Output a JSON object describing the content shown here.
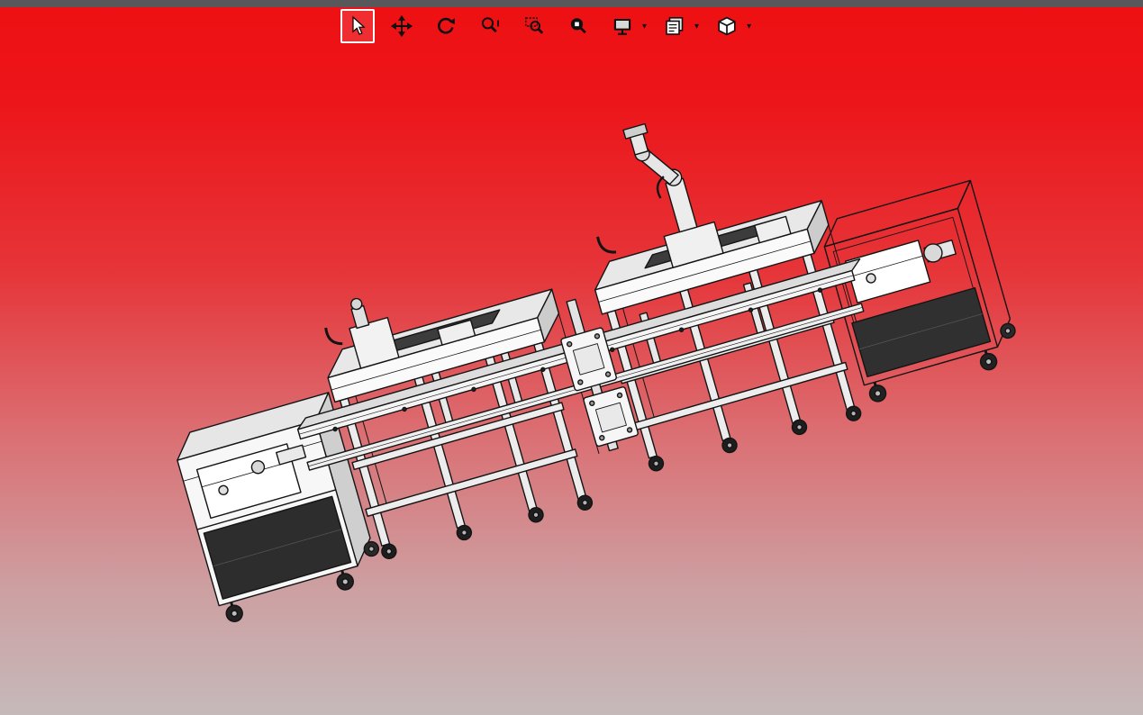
{
  "window": {
    "top_bar_color": "#58585a"
  },
  "viewport": {
    "background_gradient_top": "#ee1013",
    "background_gradient_bottom": "#c6b9ba",
    "model_fill": "#ffffff",
    "model_edge": "#141414",
    "model_description": "3D CAD assembly of an automated machine line: two framed process modules with tabletops, a small robot arm on top, center fixture plates, and rolling equipment carts with casters at both ends, all on aluminum extrusion frames with connecting rails"
  },
  "toolbar": {
    "buttons": [
      {
        "name": "select",
        "icon": "cursor-arrow-icon",
        "active": true,
        "has_dropdown": false
      },
      {
        "name": "pan",
        "icon": "pan-arrows-icon",
        "active": false,
        "has_dropdown": false
      },
      {
        "name": "rotate",
        "icon": "rotate-arrows-icon",
        "active": false,
        "has_dropdown": false
      },
      {
        "name": "zoom-in-out",
        "icon": "magnifier-zoom-icon",
        "active": false,
        "has_dropdown": false
      },
      {
        "name": "zoom-window",
        "icon": "magnifier-window-icon",
        "active": false,
        "has_dropdown": false
      },
      {
        "name": "zoom-fit",
        "icon": "magnifier-fit-icon",
        "active": false,
        "has_dropdown": false
      },
      {
        "name": "display-mode",
        "icon": "monitor-icon",
        "active": false,
        "has_dropdown": true
      },
      {
        "name": "standard-views",
        "icon": "sheet-views-icon",
        "active": false,
        "has_dropdown": true
      },
      {
        "name": "orientation",
        "icon": "cube-icon",
        "active": false,
        "has_dropdown": true
      }
    ],
    "dropdown_glyph": "▾"
  }
}
